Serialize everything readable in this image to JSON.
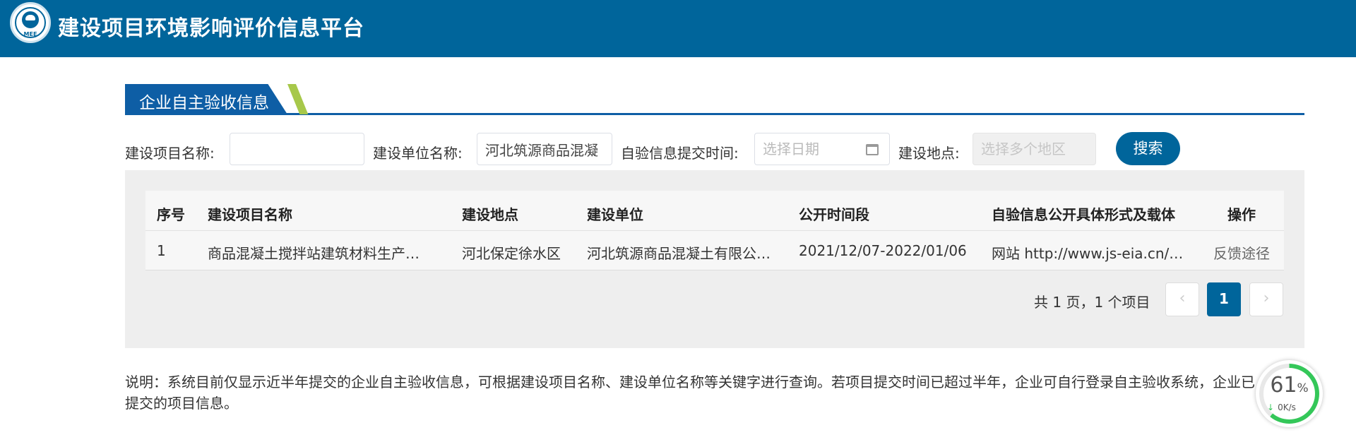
{
  "header": {
    "logo_text": "MEE",
    "title": "建设项目环境影响评价信息平台"
  },
  "section": {
    "tab_title": "企业自主验收信息"
  },
  "search": {
    "project_name_label": "建设项目名称:",
    "project_name_value": "",
    "unit_name_label": "建设单位名称:",
    "unit_name_value": "河北筑源商品混凝",
    "submit_time_label": "自验信息提交时间:",
    "date_placeholder": "选择日期",
    "location_label": "建设地点:",
    "location_placeholder": "选择多个地区",
    "search_button": "搜索"
  },
  "table": {
    "columns": [
      "序号",
      "建设项目名称",
      "建设地点",
      "建设单位",
      "公开时间段",
      "自验信息公开具体形式及载体",
      "操作"
    ],
    "rows": [
      {
        "index": "1",
        "project": "商品混凝土搅拌站建筑材料生产…",
        "location": "河北保定徐水区",
        "unit": "河北筑源商品混凝土有限公…",
        "period": "2021/12/07-2022/01/06",
        "carrier": "网站 http://www.js-eia.cn/…",
        "action": "反馈途径"
      }
    ]
  },
  "pagination": {
    "info": "共 1 页，1 个项目",
    "prev": "‹",
    "current": "1",
    "next": "›"
  },
  "note": "说明：系统目前仅显示近半年提交的企业自主验收信息，可根据建设项目名称、建设单位名称等关键字进行查询。若项目提交时间已超过半年，企业可自行登录自主验收系统，企业已提交的项目信息。",
  "speed_widget": {
    "percent": "61",
    "percent_sign": "%",
    "rate": "0K/s",
    "arrow": "↓",
    "progress": 0.61
  },
  "colors": {
    "header_bg": "#00659b",
    "accent_stripe": "#a7c84a",
    "section_blue": "#0e5ea5"
  }
}
